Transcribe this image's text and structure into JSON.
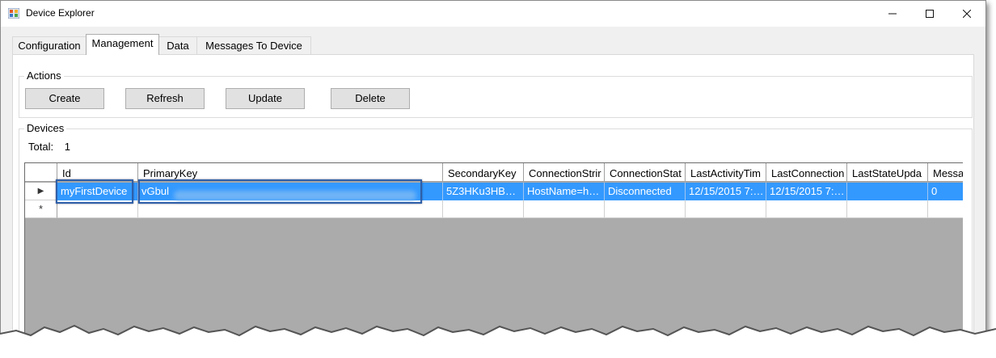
{
  "window": {
    "title": "Device Explorer"
  },
  "tabs": [
    {
      "label": "Configuration"
    },
    {
      "label": "Management"
    },
    {
      "label": "Data"
    },
    {
      "label": "Messages To Device"
    }
  ],
  "actions": {
    "title": "Actions",
    "create_label": "Create",
    "refresh_label": "Refresh",
    "update_label": "Update",
    "delete_label": "Delete"
  },
  "devices": {
    "title": "Devices",
    "total_label": "Total:",
    "total_value": "1",
    "columns": [
      "Id",
      "PrimaryKey",
      "SecondaryKey",
      "ConnectionStrir",
      "ConnectionStat",
      "LastActivityTim",
      "LastConnection",
      "LastStateUpda",
      "Messa"
    ],
    "rows": [
      [
        "myFirstDevice",
        "vGbul",
        "5Z3HKu3HB…",
        "HostName=h…",
        "Disconnected",
        "12/15/2015 7:…",
        "12/15/2015 7:…",
        "",
        "0"
      ]
    ],
    "new_row_marker": "*",
    "selected_row_marker": "▶"
  },
  "colors": {
    "selection": "#3399ff",
    "highlight_box": "#2f5fa8",
    "grid_background": "#ababab"
  },
  "icons": [
    "app-icon",
    "minimize-icon",
    "maximize-icon",
    "close-icon"
  ]
}
